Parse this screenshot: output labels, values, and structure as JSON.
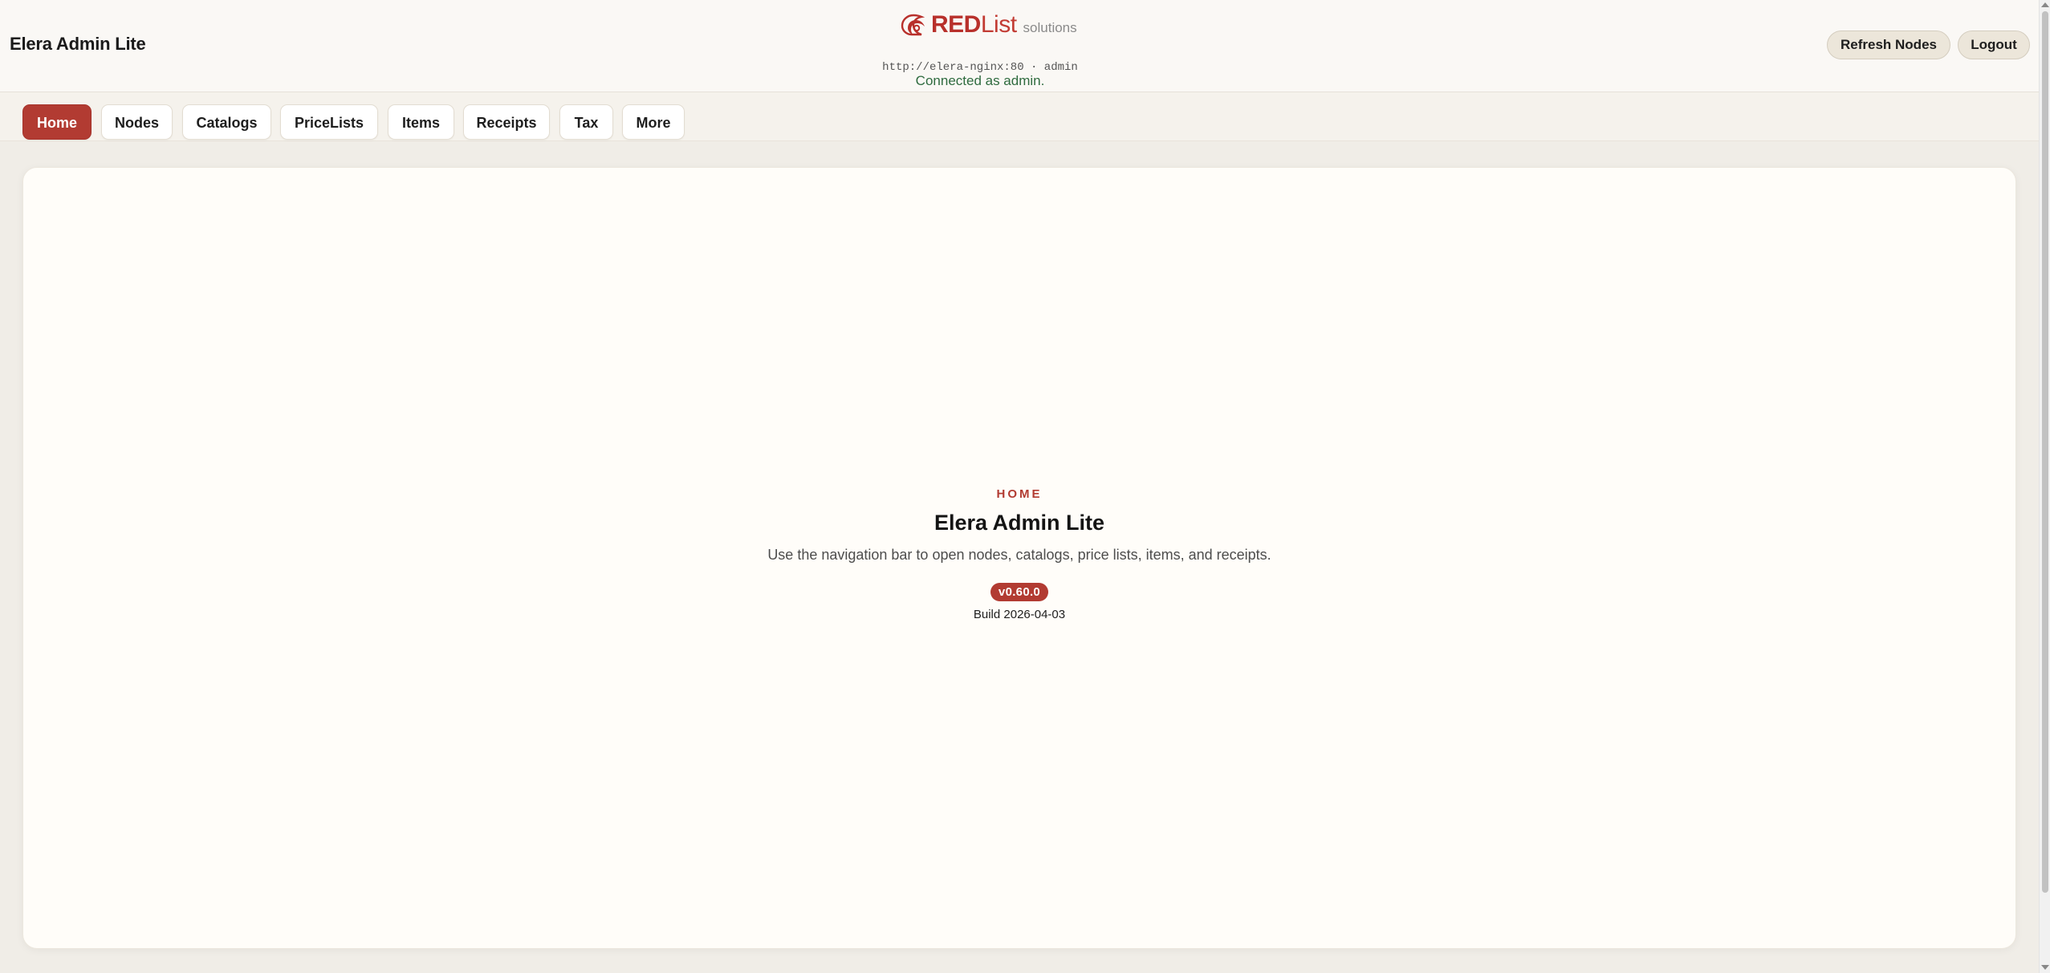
{
  "header": {
    "app_title": "Elera Admin Lite",
    "brand": {
      "red": "RED",
      "list": "List",
      "solutions": "solutions"
    },
    "connection_url": "http://elera-nginx:80 · admin",
    "connection_status": "Connected as admin.",
    "refresh_label": "Refresh Nodes",
    "logout_label": "Logout"
  },
  "nav": {
    "active": "Home",
    "tabs": [
      {
        "label": "Home"
      },
      {
        "label": "Nodes"
      },
      {
        "label": "Catalogs"
      },
      {
        "label": "PriceLists"
      },
      {
        "label": "Items"
      },
      {
        "label": "Receipts"
      },
      {
        "label": "Tax"
      },
      {
        "label": "More"
      }
    ]
  },
  "main": {
    "eyebrow": "HOME",
    "title": "Elera Admin Lite",
    "description": "Use the navigation bar to open nodes, catalogs, price lists, items, and receipts.",
    "version": "v0.60.0",
    "build": "Build 2026-04-03"
  },
  "icons": {
    "brand_logo": "redlist-logo-icon"
  },
  "colors": {
    "accent": "#b23b32",
    "connected": "#2f6b3f",
    "background": "#f0ede7",
    "panel": "#fffdf9"
  }
}
